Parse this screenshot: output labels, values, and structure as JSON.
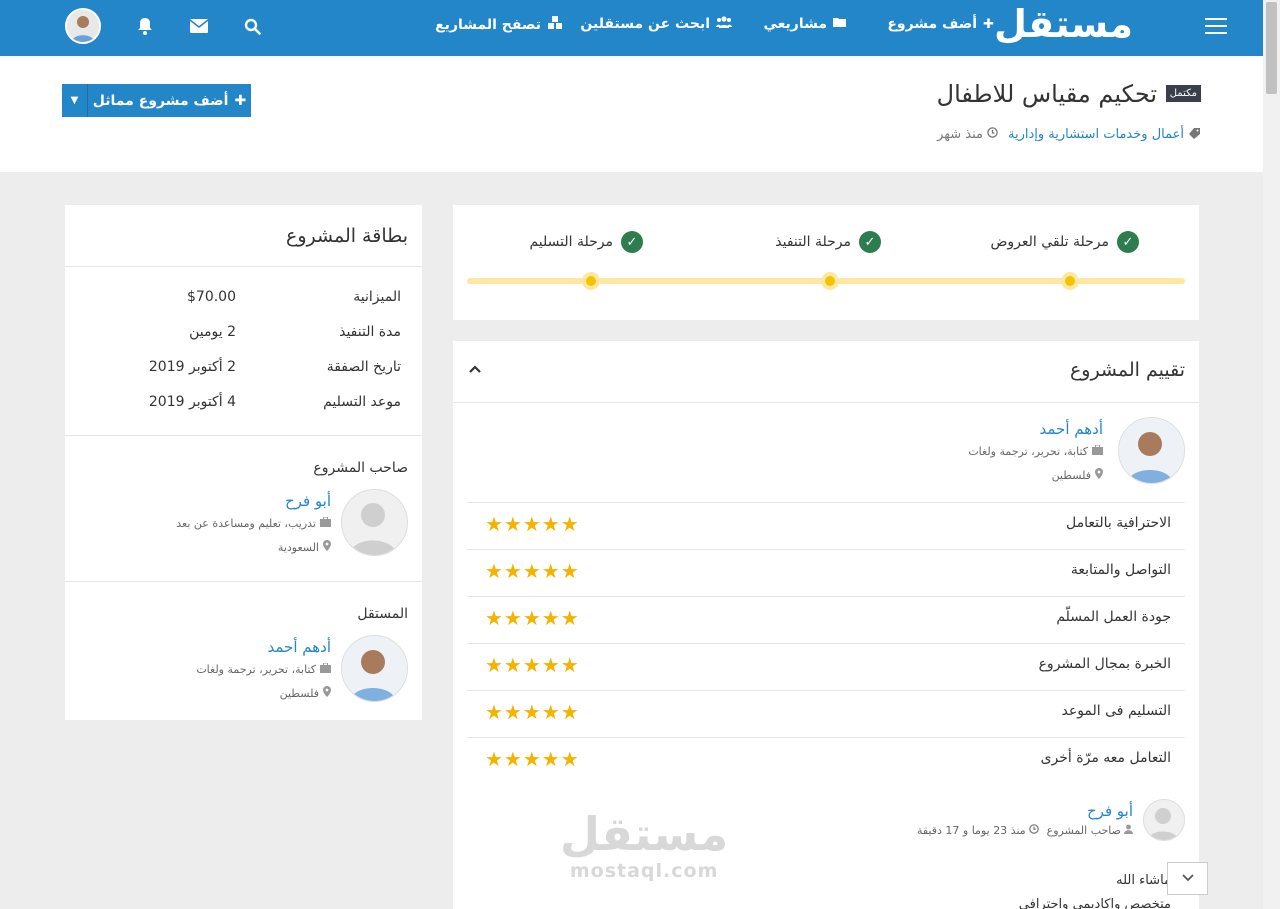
{
  "header": {
    "logo": "مستقل",
    "nav": [
      {
        "label": "أضف مشروع",
        "icon": "plus-icon"
      },
      {
        "label": "مشاريعي",
        "icon": "folder-icon"
      },
      {
        "label": "ابحث عن مستقلين",
        "icon": "users-icon"
      },
      {
        "label": "تصفح المشاريع",
        "icon": "cubes-icon"
      }
    ]
  },
  "project": {
    "status_badge": "مكتمل",
    "title": "تحكيم مقياس للاطفال",
    "category": "أعمال وخدمات استشارية وإدارية",
    "posted": "منذ شهر",
    "add_similar_label": "أضف مشروع مماثل"
  },
  "stages": [
    {
      "label": "مرحلة تلقي العروض"
    },
    {
      "label": "مرحلة التنفيذ"
    },
    {
      "label": "مرحلة التسليم"
    }
  ],
  "rating": {
    "title": "تقييم المشروع",
    "freelancer": {
      "name": "أدهم أحمد",
      "skills": "كتابة، تحرير، ترجمة ولغات",
      "location": "فلسطين"
    },
    "criteria": [
      {
        "label": "الاحترافية بالتعامل",
        "stars": 5
      },
      {
        "label": "التواصل والمتابعة",
        "stars": 5
      },
      {
        "label": "جودة العمل المسلّم",
        "stars": 5
      },
      {
        "label": "الخبرة بمجال المشروع",
        "stars": 5
      },
      {
        "label": "التسليم فى الموعد",
        "stars": 5
      },
      {
        "label": "التعامل معه مرّة أخرى",
        "stars": 5
      }
    ],
    "comment": {
      "author": "أبو فرح",
      "role": "صاحب المشروع",
      "time": "منذ 23 يوما و 17 دقيقة",
      "line1": "ماشاء الله",
      "line2": "متخصص واكاديمي واحترافي"
    }
  },
  "watermark": {
    "text": "مستقل",
    "domain": "mostaql.com"
  },
  "card": {
    "title": "بطاقة المشروع",
    "rows": [
      {
        "key": "الميزانية",
        "value": "$70.00"
      },
      {
        "key": "مدة التنفيذ",
        "value": "2 يومين"
      },
      {
        "key": "تاريخ الصفقة",
        "value": "2 أكتوبر 2019"
      },
      {
        "key": "موعد التسليم",
        "value": "4 أكتوبر 2019"
      }
    ],
    "owner_title": "صاحب المشروع",
    "owner": {
      "name": "أبو فرح",
      "skills": "تدريب، تعليم ومساعدة عن بعد",
      "location": "السعودية"
    },
    "freelancer_title": "المستقل",
    "freelancer": {
      "name": "أدهم أحمد",
      "skills": "كتابة، تحرير، ترجمة ولغات",
      "location": "فلسطين"
    }
  },
  "colors": {
    "brand": "#2386c8",
    "success": "#2e7d4f",
    "star": "#f5b301"
  }
}
